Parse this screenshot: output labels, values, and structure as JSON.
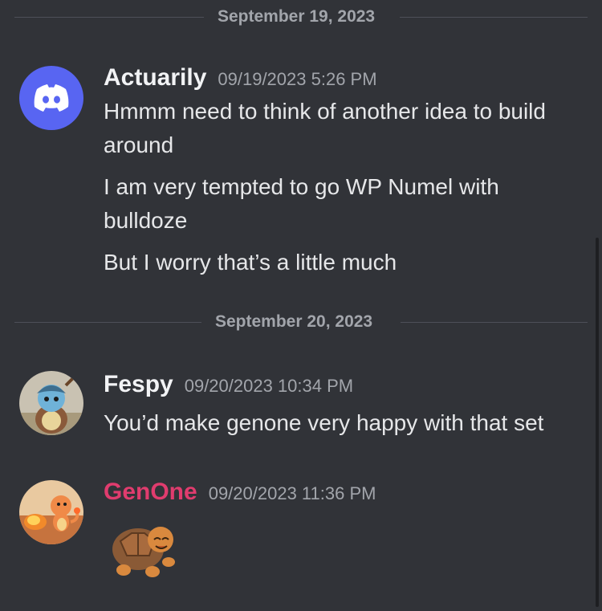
{
  "dividers": {
    "first": "September 19, 2023",
    "second": "September 20, 2023"
  },
  "messages": [
    {
      "author": "Actuarily",
      "author_color": "#f2f3f5",
      "timestamp": "09/19/2023 5:26 PM",
      "avatar_icon": "discord-logo-icon",
      "lines": [
        "Hmmm need to think of another idea to build around",
        "I am very tempted to go WP Numel with bulldoze",
        "But I worry that’s a little much"
      ]
    },
    {
      "author": "Fespy",
      "author_color": "#f2f3f5",
      "timestamp": "09/20/2023 10:34 PM",
      "avatar_icon": "squirtle-avatar",
      "lines": [
        "You’d make genone very happy with that set"
      ]
    },
    {
      "author": "GenOne",
      "author_color": "#e03c6e",
      "timestamp": "09/20/2023 11:36 PM",
      "avatar_icon": "charmander-avatar",
      "sticker": "torkoal-sticker"
    }
  ],
  "colors": {
    "background": "#313338",
    "blurple": "#5865f2",
    "muted": "#a2a5ab"
  }
}
